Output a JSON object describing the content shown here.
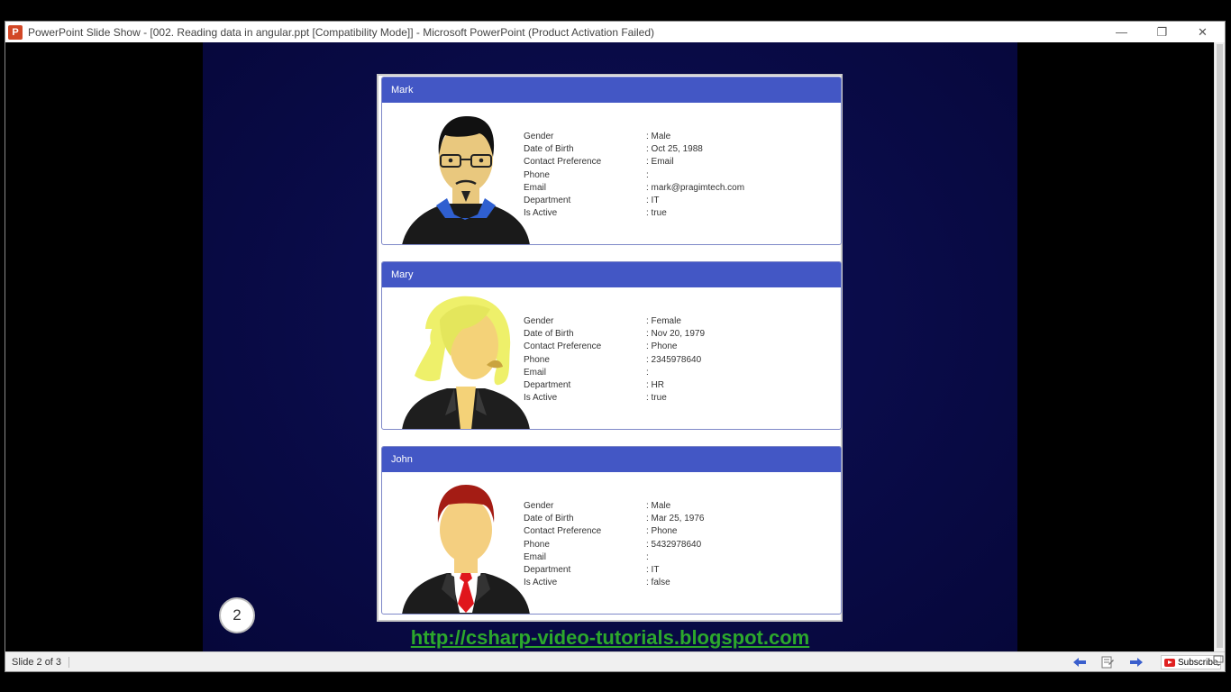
{
  "window": {
    "title": "PowerPoint Slide Show - [002. Reading data in angular.ppt [Compatibility Mode]] - Microsoft PowerPoint (Product Activation Failed)",
    "app_icon_letter": "P",
    "minimize_glyph": "—",
    "restore_glyph": "❐",
    "close_glyph": "✕"
  },
  "slide": {
    "number": "2",
    "link_text": "http://csharp-video-tutorials.blogspot.com",
    "cards": [
      {
        "name": "Mark",
        "avatar": "male-glasses-avatar-icon",
        "rows": [
          {
            "label": "Gender",
            "value": ": Male"
          },
          {
            "label": "Date of Birth",
            "value": ": Oct 25, 1988"
          },
          {
            "label": "Contact Preference",
            "value": ": Email"
          },
          {
            "label": "Phone",
            "value": ":"
          },
          {
            "label": "Email",
            "value": ": mark@pragimtech.com"
          },
          {
            "label": "Department",
            "value": ": IT"
          },
          {
            "label": "Is Active",
            "value": ": true"
          }
        ]
      },
      {
        "name": "Mary",
        "avatar": "female-blonde-avatar-icon",
        "rows": [
          {
            "label": "Gender",
            "value": ": Female"
          },
          {
            "label": "Date of Birth",
            "value": ": Nov 20, 1979"
          },
          {
            "label": "Contact Preference",
            "value": ": Phone"
          },
          {
            "label": "Phone",
            "value": ": 2345978640"
          },
          {
            "label": "Email",
            "value": ":"
          },
          {
            "label": "Department",
            "value": ": HR"
          },
          {
            "label": "Is Active",
            "value": ": true"
          }
        ]
      },
      {
        "name": "John",
        "avatar": "male-suit-avatar-icon",
        "rows": [
          {
            "label": "Gender",
            "value": ": Male"
          },
          {
            "label": "Date of Birth",
            "value": ": Mar 25, 1976"
          },
          {
            "label": "Contact Preference",
            "value": ": Phone"
          },
          {
            "label": "Phone",
            "value": ": 5432978640"
          },
          {
            "label": "Email",
            "value": ":"
          },
          {
            "label": "Department",
            "value": ": IT"
          },
          {
            "label": "Is Active",
            "value": ": false"
          }
        ]
      }
    ]
  },
  "statusbar": {
    "slide_counter": "Slide 2 of 3",
    "prev_icon": "arrow-left-icon",
    "menu_icon": "slide-menu-icon",
    "next_icon": "arrow-right-icon",
    "subscribe_label": "Subscribe"
  },
  "colors": {
    "card_header": "#4357c5",
    "slide_background": "#0a0c4a",
    "link": "#2ca82c"
  }
}
